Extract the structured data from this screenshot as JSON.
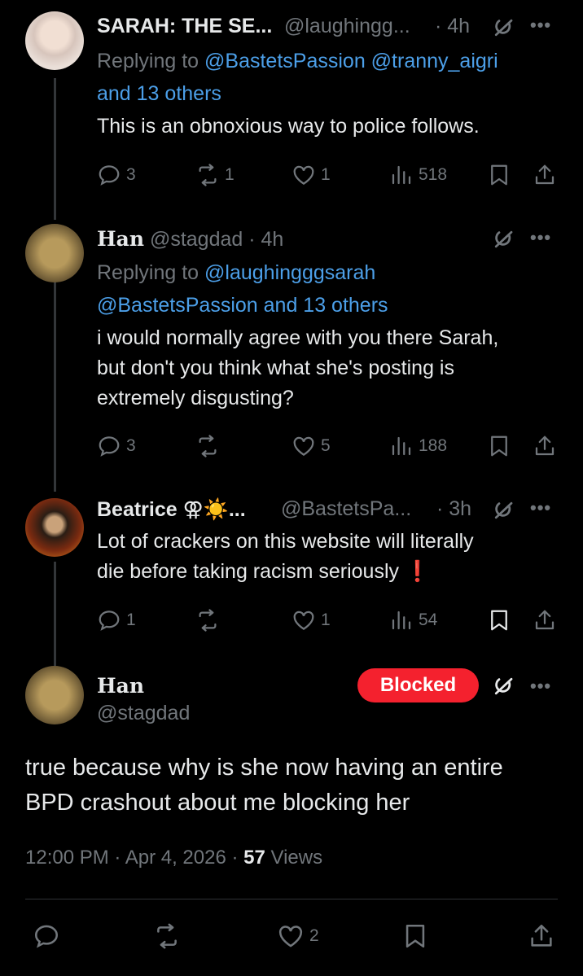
{
  "tweets": [
    {
      "name": "SARAH: THE SE...",
      "handle": "@laughingg...",
      "time": "· 4h",
      "replying_prefix": "Replying to",
      "replying_line1": "@BastetsPassion @tranny_aigri",
      "replying_line2": "and 13 others",
      "text_lines": [
        "This is an obnoxious way to police follows."
      ],
      "replies": "3",
      "retweets": "1",
      "likes": "1",
      "views": "518"
    },
    {
      "name": "Han",
      "handle": "@stagdad · 4h",
      "replying_prefix": "Replying to",
      "replying_line1": "@laughingggsarah",
      "replying_line2": "@BastetsPassion and 13 others",
      "text_lines": [
        "i would normally agree with you there Sarah,",
        "but don't you think what she's posting is",
        "extremely disgusting?"
      ],
      "replies": "3",
      "retweets": "",
      "likes": "5",
      "views": "188"
    },
    {
      "name": "Beatrice ⚢☀️...",
      "handle": "@BastetsPa...",
      "time": "· 3h",
      "text_lines": [
        "Lot of crackers on this website will literally",
        "die before taking racism seriously ❗"
      ],
      "replies": "1",
      "retweets": "",
      "likes": "1",
      "views": "54"
    }
  ],
  "main": {
    "name": "Han",
    "handle": "@stagdad",
    "blocked_label": "Blocked",
    "text_lines": [
      "true because why is she now having an entire",
      "BPD crashout about me blocking her"
    ],
    "timestamp": "12:00 PM · Apr 4, 2026 · ",
    "views_count": "57",
    "views_label": " Views",
    "likes": "2"
  },
  "icons": [
    "reply-icon",
    "retweet-icon",
    "like-icon",
    "views-icon",
    "bookmark-icon",
    "share-icon",
    "grok-icon",
    "more-icon"
  ],
  "colors": {
    "background": "#000000",
    "text": "#e7e9ea",
    "muted": "#71767b",
    "link": "#4c9fe8",
    "blocked": "#f4212e"
  }
}
